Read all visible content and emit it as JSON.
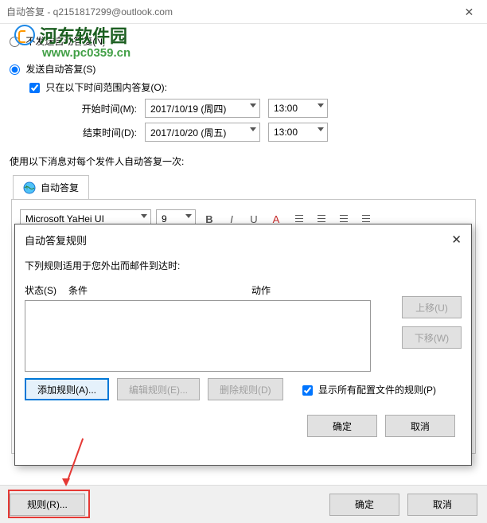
{
  "title": "自动答复 - q2151817299@outlook.com",
  "watermark": {
    "text": "河东软件园",
    "url": "www.pc0359.cn"
  },
  "options": {
    "no_send": "不发送自动答复(N)",
    "send": "发送自动答复(S)",
    "time_range": "只在以下时间范围内答复(O):",
    "start_label": "开始时间(M):",
    "end_label": "结束时间(D):",
    "start_date": "2017/10/19 (周四)",
    "end_date": "2017/10/20 (周五)",
    "start_time": "13:00",
    "end_time": "13:00"
  },
  "reply_once": "使用以下消息对每个发件人自动答复一次:",
  "tab": "自动答复",
  "toolbar": {
    "font": "Microsoft YaHei UI",
    "size": "9"
  },
  "dialog": {
    "title": "自动答复规则",
    "msg": "下列规则适用于您外出而邮件到达时:",
    "col_state": "状态(S)",
    "col_cond": "条件",
    "col_action": "动作",
    "move_up": "上移(U)",
    "move_down": "下移(W)",
    "add_rule": "添加规则(A)...",
    "edit_rule": "编辑规则(E)...",
    "del_rule": "删除规则(D)",
    "show_all": "显示所有配置文件的规则(P)",
    "ok": "确定",
    "cancel": "取消"
  },
  "footer": {
    "rules": "规则(R)...",
    "ok": "确定",
    "cancel": "取消"
  }
}
